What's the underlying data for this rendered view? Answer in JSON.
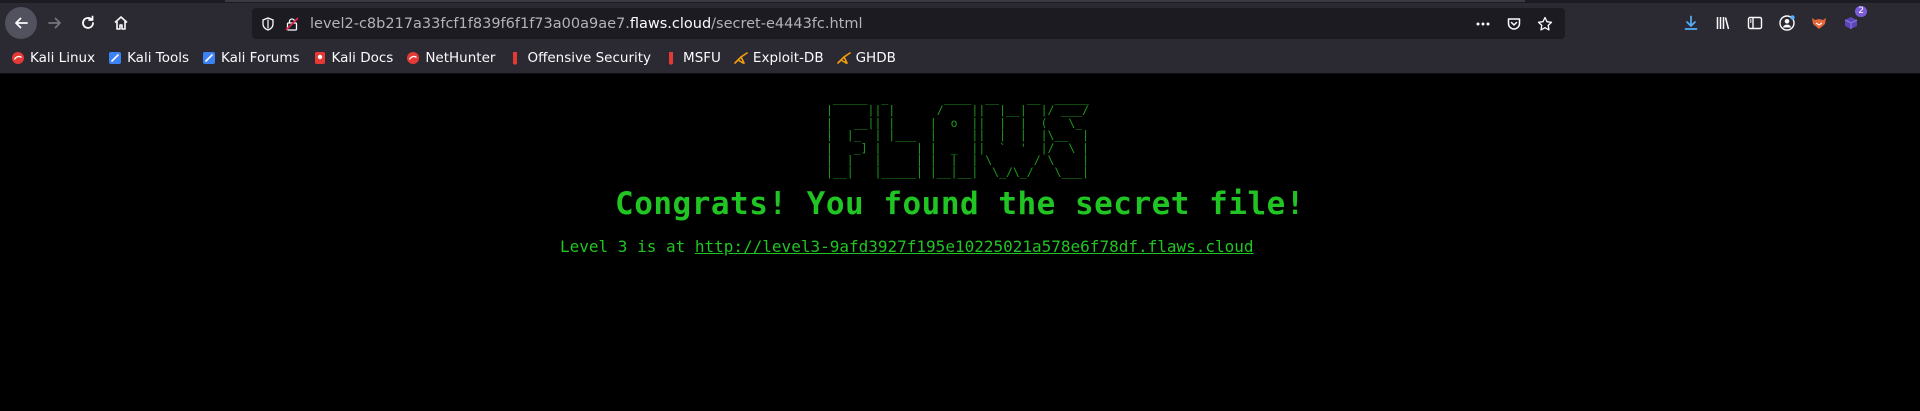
{
  "browser": {
    "url_prefix": "level2-c8b217a33fcf1f839f6f1f73a00a9ae7.",
    "url_host": "flaws.cloud",
    "url_path": "/secret-e4443fc.html",
    "extensions_badge": "2"
  },
  "bookmarks": [
    {
      "label": "Kali Linux",
      "icon": "kali-dragon-icon",
      "color": "#e53935"
    },
    {
      "label": "Kali Tools",
      "icon": "kali-tools-icon",
      "color": "#3b82f6"
    },
    {
      "label": "Kali Forums",
      "icon": "kali-forums-icon",
      "color": "#3b82f6"
    },
    {
      "label": "Kali Docs",
      "icon": "kali-docs-icon",
      "color": "#e53935"
    },
    {
      "label": "NetHunter",
      "icon": "nethunter-icon",
      "color": "#e53935"
    },
    {
      "label": "Offensive Security",
      "icon": "offsec-icon",
      "color": "#e53935"
    },
    {
      "label": "MSFU",
      "icon": "msfu-icon",
      "color": "#e53935"
    },
    {
      "label": "Exploit-DB",
      "icon": "exploit-db-icon",
      "color": "#f59e0b"
    },
    {
      "label": "GHDB",
      "icon": "ghdb-icon",
      "color": "#f59e0b"
    }
  ],
  "page": {
    "ascii_logo": " _____  _        ____  __    __  _____\n|     || |      /    ||  |__|  |/ ___/\n|   __|| |     |  o  ||  |  |  (   \\_ \n|  |_  | |___  |     ||  |  |  |\\__  |\n|   _] |     | |  _  ||  `  '  |/  \\ |\n|  |   |     | |  |  | \\      / \\    |\n|__|   |_____| |__|__|  \\_/\\_/   \\___|",
    "congrats": "Congrats! You found the secret file!",
    "level_text": "Level 3 is at ",
    "level_link": "http://level3-9afd3927f195e10225021a578e6f78df.flaws.cloud"
  },
  "colors": {
    "page_background": "#000000",
    "text_green": "#21c523",
    "chrome_background": "#2b2a33",
    "urlbar_background": "#1c1b22"
  }
}
